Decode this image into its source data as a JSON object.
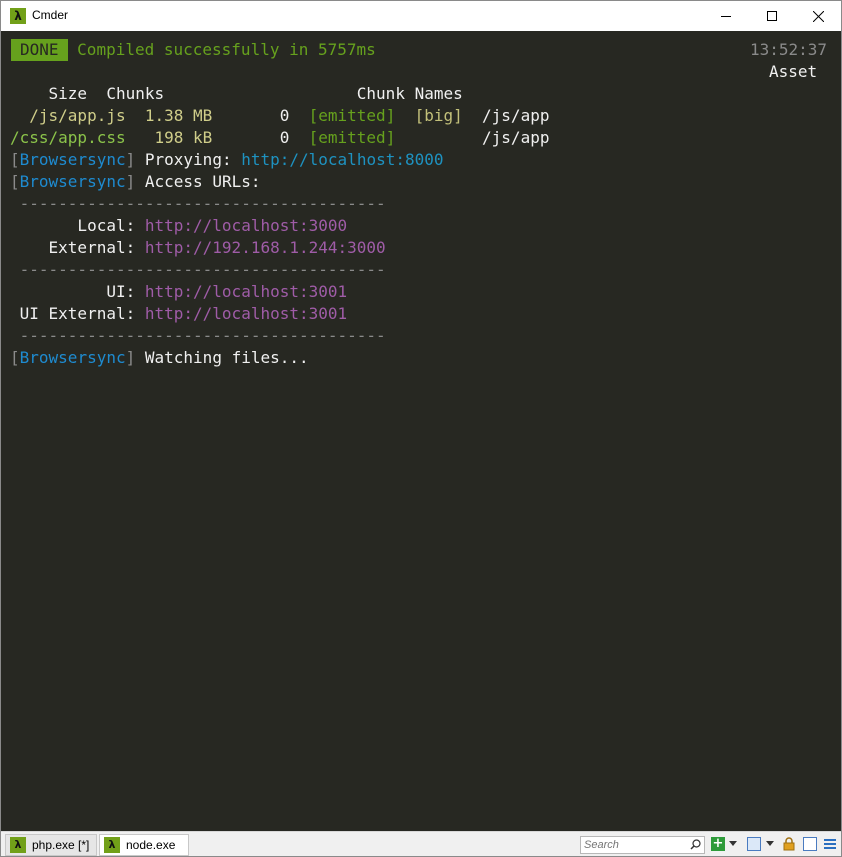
{
  "window": {
    "title": "Cmder",
    "icon": "lambda-icon",
    "icon_glyph": "λ"
  },
  "terminal": {
    "background": "#272822",
    "timestamp": "13:52:37",
    "asset_header": "Asset",
    "done_label": "DONE",
    "compiled_text": "Compiled successfully in 5757ms",
    "table_header": "    Size  Chunks                    Chunk Names",
    "rows": [
      {
        "asset": "  /js/app.js",
        "size": "  1.38 MB",
        "chunk": "       0",
        "emitted": "  [emitted]",
        "flag": "  [big]",
        "name": "  /js/app"
      },
      {
        "asset": "/css/app.css",
        "size": "   198 kB",
        "chunk": "       0",
        "emitted": "  [emitted]",
        "flag": "       ",
        "name": "  /js/app"
      }
    ],
    "browsersync_tag": "Browsersync",
    "proxying_label": " Proxying: ",
    "proxying_url": "http://localhost:8000",
    "access_label": " Access URLs:",
    "divider": " --------------------------------------",
    "local_label": "       Local: ",
    "local_url": "http://localhost:3000",
    "external_label": "    External: ",
    "external_url": "http://192.168.1.244:3000",
    "ui_label": "          UI: ",
    "ui_url": "http://localhost:3001",
    "ui_external_label": " UI External: ",
    "ui_external_url": "http://localhost:3001",
    "watching_label": " Watching files..."
  },
  "statusbar": {
    "tabs": [
      {
        "label": "php.exe [*]",
        "icon": "lambda-icon"
      },
      {
        "label": "node.exe",
        "icon": "lambda-icon"
      }
    ],
    "search_placeholder": "Search"
  },
  "colors": {
    "green": "#66a11d",
    "blue": "#1e8bd0",
    "purple": "#9f5ca7",
    "gray": "#8a8a8a"
  }
}
